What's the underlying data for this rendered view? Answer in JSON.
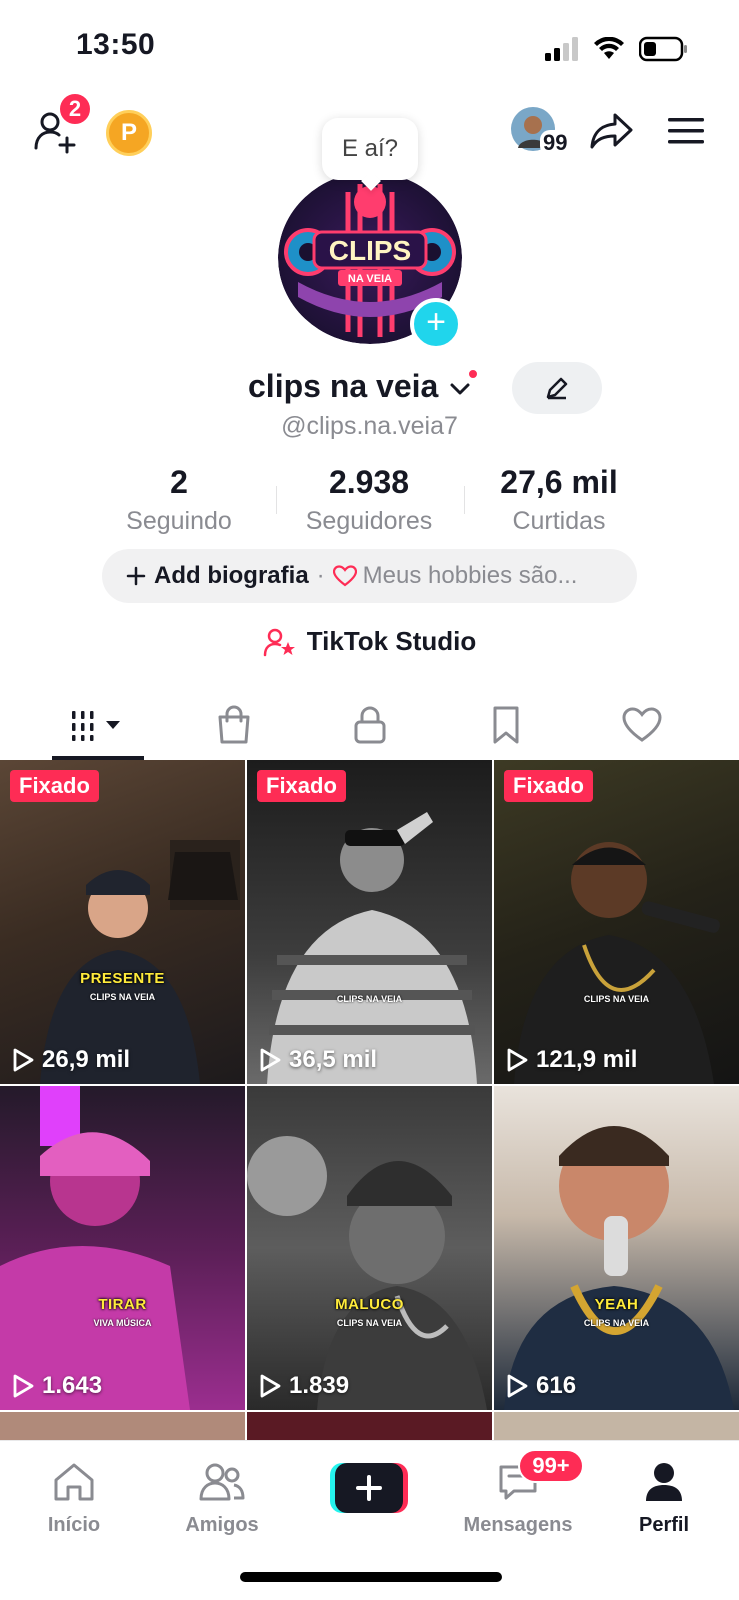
{
  "status_bar": {
    "time": "13:50"
  },
  "topbar": {
    "friend_requests_badge": "2",
    "coin_letter": "P",
    "profile_views_count": "99"
  },
  "profile": {
    "speech_bubble": "E aí?",
    "avatar_logo_main": "CLIPS",
    "avatar_logo_sub": "NA VEIA",
    "display_name": "clips na veia",
    "handle": "@clips.na.veia7"
  },
  "stats": [
    {
      "value": "2",
      "label": "Seguindo"
    },
    {
      "value": "2.938",
      "label": "Seguidores"
    },
    {
      "value": "27,6 mil",
      "label": "Curtidas"
    }
  ],
  "bio": {
    "add_label": "Add biografia",
    "separator": "·",
    "hobbies": "Meus hobbies são..."
  },
  "studio_label": "TikTok Studio",
  "tabs": [
    "videos-icon",
    "shop-icon",
    "lock-icon",
    "bookmark-icon",
    "heart-icon"
  ],
  "videos": [
    {
      "pinned": "Fixado",
      "views": "26,9 mil",
      "caption": "PRESENTE",
      "sub": "CLIPS NA VEIA"
    },
    {
      "pinned": "Fixado",
      "views": "36,5 mil",
      "caption": "",
      "sub": "CLIPS NA VEIA"
    },
    {
      "pinned": "Fixado",
      "views": "121,9 mil",
      "caption": "",
      "sub": "CLIPS NA VEIA"
    },
    {
      "pinned": "",
      "views": "1.643",
      "caption": "TIRAR",
      "sub": "VIVA MÚSICA"
    },
    {
      "pinned": "",
      "views": "1.839",
      "caption": "MALUCO",
      "sub": "CLIPS NA VEIA"
    },
    {
      "pinned": "",
      "views": "616",
      "caption": "YEAH",
      "sub": "CLIPS NA VEIA"
    }
  ],
  "bottom_nav": {
    "home": "Início",
    "friends": "Amigos",
    "messages": "Mensagens",
    "messages_badge": "99+",
    "profile": "Perfil"
  },
  "colors": {
    "accent": "#fe2c55",
    "cyan": "#20d5ec",
    "text": "#161823",
    "muted": "#8a8b91"
  }
}
